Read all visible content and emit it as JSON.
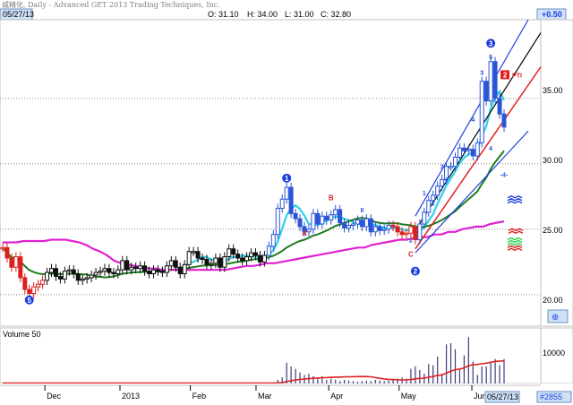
{
  "window": {
    "title": "威精化, Daily - Advanced GET 2013 Trading Techniques, Inc.",
    "date_badge": "05/27/13",
    "net_change": "+0.50",
    "corner_icon": "zoom-icon"
  },
  "ohlc": {
    "open": "O: 31.10",
    "high": "H: 34.00",
    "low": "L: 31.00",
    "close": "C: 32.80"
  },
  "price_axis": {
    "ticks": [
      "35.00",
      "30.00",
      "25.00",
      "20.00"
    ]
  },
  "volume_panel": {
    "label": "Volume 50",
    "tick": "10000"
  },
  "time_axis": {
    "labels": [
      "Dec",
      "2013",
      "Feb",
      "Mar",
      "Apr",
      "May",
      "Jun"
    ],
    "cursor_date": "05/27/13",
    "record_count": "#2855"
  },
  "annotations": {
    "waves": [
      "1",
      "2",
      "3",
      "4",
      "5"
    ],
    "abc": [
      "A",
      "B",
      "C"
    ],
    "minor": [
      "2",
      "3",
      "4",
      "5",
      "4",
      "3",
      "4",
      "II",
      "1",
      "2"
    ],
    "target": "-4-",
    "marker": "PTI",
    "marker_value": "2"
  },
  "colors": {
    "bar_up": "#2a55d6",
    "bar_down": "#dd1f1f",
    "bar_neutral": "#101010",
    "ma_fast": "#30d0ea",
    "ma_mid": "#1e7a1e",
    "ma_slow": "#e020d0",
    "channel_blue": "#1e3ee0",
    "channel_black": "#000000",
    "channel_red": "#e02020",
    "volume": "#3b3b7a",
    "volume_ma": "#e02020",
    "badge_blue": "#1e3ee0"
  },
  "chart_data": {
    "type": "candlestick",
    "x_range": [
      "2012-11-13",
      "2013-06-30"
    ],
    "ylim": [
      17.6,
      41.0
    ],
    "volume_ylim": [
      0,
      22000
    ],
    "price": [
      23.6,
      22.8,
      22.1,
      22.9,
      21.3,
      20.4,
      20.1,
      20.6,
      20.8,
      21.1,
      21.7,
      22.0,
      21.4,
      21.2,
      21.8,
      21.9,
      21.6,
      21.1,
      21.2,
      21.3,
      21.5,
      21.7,
      21.8,
      22.0,
      21.7,
      21.6,
      21.9,
      22.6,
      21.9,
      22.1,
      22.0,
      22.2,
      21.8,
      21.6,
      21.9,
      21.8,
      21.7,
      22.2,
      22.6,
      22.1,
      21.6,
      22.3,
      23.3,
      23.3,
      22.8,
      22.7,
      22.3,
      22.4,
      22.8,
      22.1,
      22.9,
      23.5,
      23.1,
      22.8,
      22.6,
      22.9,
      23.2,
      23.0,
      22.5,
      23.0,
      23.7,
      24.6,
      26.6,
      27.3,
      28.2,
      26.2,
      25.8,
      25.2,
      24.8,
      25.0,
      26.2,
      25.4,
      26.0,
      25.7,
      26.1,
      26.5,
      25.5,
      25.1,
      25.3,
      25.4,
      25.7,
      25.2,
      25.8,
      24.8,
      25.2,
      24.9,
      25.0,
      25.3,
      25.2,
      24.8,
      24.6,
      24.7,
      25.2,
      24.2,
      25.4,
      26.3,
      27.2,
      27.6,
      28.3,
      28.8,
      29.8,
      29.8,
      30.5,
      31.2,
      31.0,
      31.1,
      30.6,
      31.6,
      36.3,
      34.8,
      37.8,
      35.0,
      33.8,
      32.8
    ],
    "volume": [
      150,
      150,
      200,
      250,
      200,
      150,
      200,
      150,
      150,
      100,
      150,
      200,
      150,
      150,
      120,
      130,
      150,
      150,
      160,
      150,
      150,
      200,
      250,
      180,
      150,
      170,
      200,
      180,
      200,
      150,
      150,
      200,
      200,
      150,
      150,
      200,
      150,
      160,
      180,
      150,
      200,
      150,
      150,
      200,
      150,
      150,
      150,
      200,
      200,
      250,
      150,
      150,
      200,
      150,
      150,
      150,
      150,
      200,
      150,
      200,
      300,
      400,
      1500,
      2500,
      8500,
      7000,
      6000,
      4500,
      3500,
      4000,
      3000,
      2000,
      3000,
      1500,
      2000,
      1500,
      1000,
      1500,
      1200,
      1000,
      800,
      1000,
      1200,
      1000,
      1500,
      1200,
      1000,
      1200,
      1500,
      2000,
      2500,
      2000,
      6000,
      7000,
      5500,
      4000,
      8000,
      7500,
      11000,
      4000,
      16000,
      16500,
      14000,
      5500,
      11500,
      19000,
      9000,
      3500,
      7000,
      7000,
      9000,
      10000,
      7500,
      10000
    ],
    "series": [
      {
        "values": [
          24.0,
          24.0,
          24.0,
          24.1,
          24.1,
          24.1,
          24.1,
          24.2,
          24.2,
          24.2,
          24.1,
          24.0,
          23.8,
          23.5,
          23.3,
          23.0,
          22.6,
          22.4,
          22.3,
          22.2,
          22.1,
          22.0,
          22.0,
          21.9,
          21.9,
          21.9,
          21.9,
          21.9,
          21.9,
          21.9,
          21.9,
          21.9,
          21.9,
          22.0,
          22.1,
          22.2,
          22.2,
          22.3,
          22.4,
          22.4,
          22.5,
          22.6,
          22.7,
          22.8,
          22.9,
          23.0,
          23.1,
          23.2,
          23.3,
          23.4,
          23.5,
          23.6,
          23.6,
          23.8,
          23.9,
          24.0,
          24.1,
          24.2,
          24.2,
          24.3,
          24.4,
          24.4,
          24.6,
          24.6,
          24.8,
          24.8,
          25.0,
          25.1,
          25.2,
          25.2,
          25.4,
          25.5,
          25.6
        ]
      }
    ]
  }
}
